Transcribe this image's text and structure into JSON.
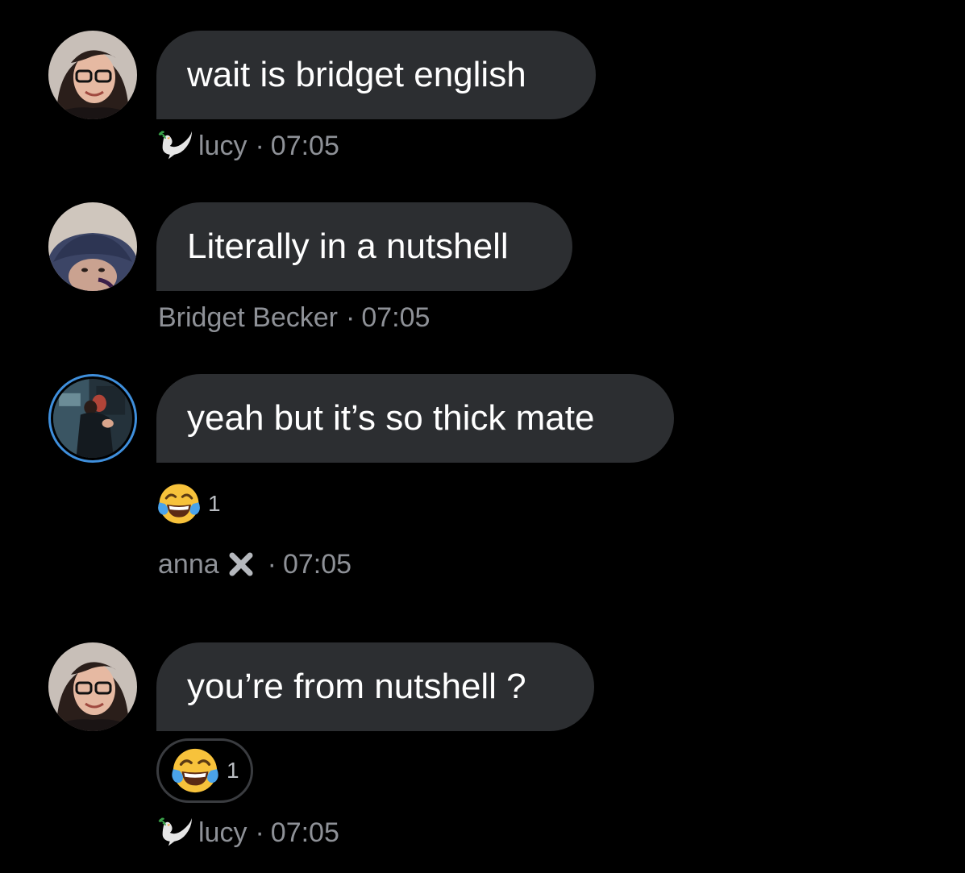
{
  "messages": [
    {
      "text": "wait is bridget english",
      "sender": "lucy",
      "time": "07:05",
      "sender_icon": "dove-icon"
    },
    {
      "text": "Literally in a nutshell",
      "sender": "Bridget Becker",
      "time": "07:05"
    },
    {
      "text": "yeah but it’s so thick mate",
      "sender": "anna",
      "time": "07:05",
      "sender_badge": "x-mark-icon",
      "reaction": {
        "emoji": "tears-of-joy-emoji",
        "count": "1"
      }
    },
    {
      "text": "you’re from nutshell ?",
      "sender": "lucy",
      "time": "07:05",
      "sender_icon": "dove-icon",
      "reaction": {
        "emoji": "tears-of-joy-emoji",
        "count": "1",
        "selected": true
      }
    }
  ],
  "separator": "·",
  "colors": {
    "background": "#000000",
    "bubble": "#2c2e31",
    "meta_text": "#8e9197",
    "story_ring": "#3f8fdc"
  }
}
